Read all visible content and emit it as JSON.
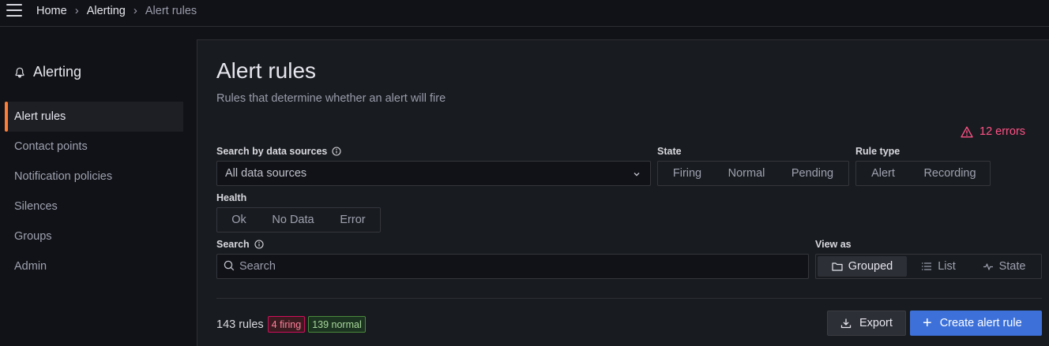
{
  "topbar": {
    "breadcrumb": [
      "Home",
      "Alerting",
      "Alert rules"
    ]
  },
  "sidebar": {
    "title": "Alerting",
    "items": [
      {
        "label": "Alert rules",
        "active": true
      },
      {
        "label": "Contact points",
        "active": false
      },
      {
        "label": "Notification policies",
        "active": false
      },
      {
        "label": "Silences",
        "active": false
      },
      {
        "label": "Groups",
        "active": false
      },
      {
        "label": "Admin",
        "active": false
      }
    ]
  },
  "page": {
    "title": "Alert rules",
    "subtitle": "Rules that determine whether an alert will fire"
  },
  "errors": {
    "text": "12 errors",
    "color": "#ff5286"
  },
  "filters": {
    "datasource": {
      "label": "Search by data sources",
      "value": "All data sources"
    },
    "state": {
      "label": "State",
      "options": [
        "Firing",
        "Normal",
        "Pending"
      ]
    },
    "rule_type": {
      "label": "Rule type",
      "options": [
        "Alert",
        "Recording"
      ]
    },
    "health": {
      "label": "Health",
      "options": [
        "Ok",
        "No Data",
        "Error"
      ]
    },
    "search": {
      "label": "Search",
      "placeholder": "Search",
      "value": ""
    },
    "view_as": {
      "label": "View as",
      "options": [
        "Grouped",
        "List",
        "State"
      ],
      "selected": "Grouped"
    }
  },
  "summary": {
    "count": "143 rules",
    "firing": "4 firing",
    "normal": "139 normal"
  },
  "actions": {
    "export_label": "Export",
    "create_label": "Create alert rule",
    "primary_color": "#3d71d9"
  }
}
